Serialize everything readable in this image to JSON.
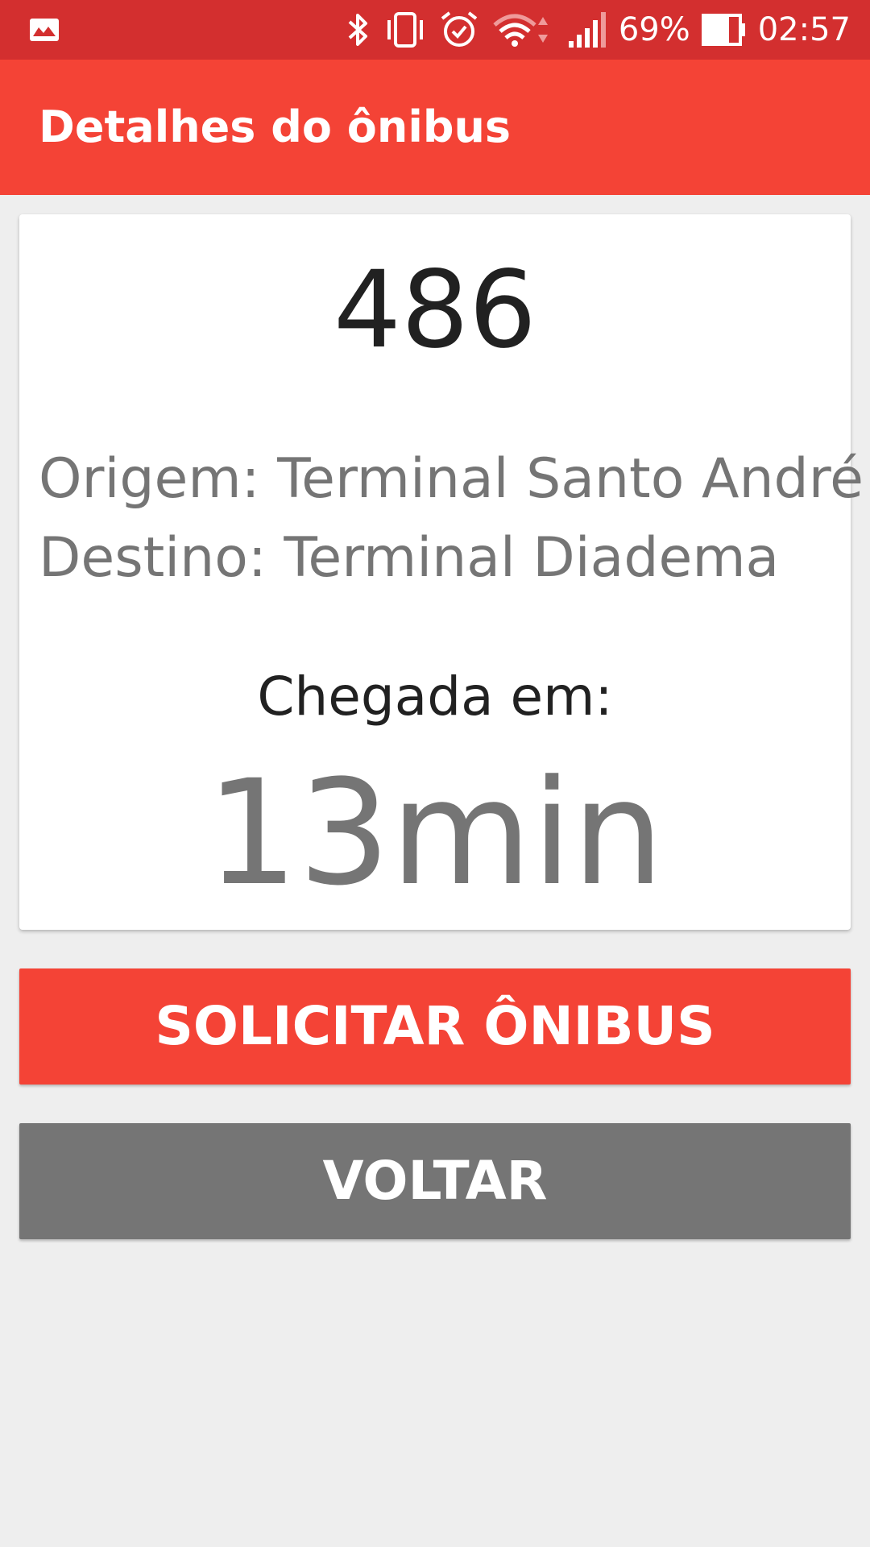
{
  "status_bar": {
    "notification_icon": "image-notification-icon",
    "icons": [
      "bluetooth-icon",
      "vibrate-icon",
      "alarm-icon",
      "wifi-icon",
      "signal-icon",
      "battery-icon"
    ],
    "battery_percent": "69%",
    "time": "02:57",
    "colors": {
      "background": "#d32f2f"
    }
  },
  "app_bar": {
    "title": "Detalhes do ônibus",
    "color": "#f44336"
  },
  "details": {
    "bus_number": "486",
    "origin": "Origem: Terminal Santo André",
    "destination": "Destino: Terminal Diadema",
    "arrival_label": "Chegada em:",
    "arrival_time": "13min"
  },
  "actions": {
    "request_label": "SOLICITAR ÔNIBUS",
    "back_label": "VOLTAR",
    "colors": {
      "request": "#f44336",
      "back": "#757575"
    }
  }
}
